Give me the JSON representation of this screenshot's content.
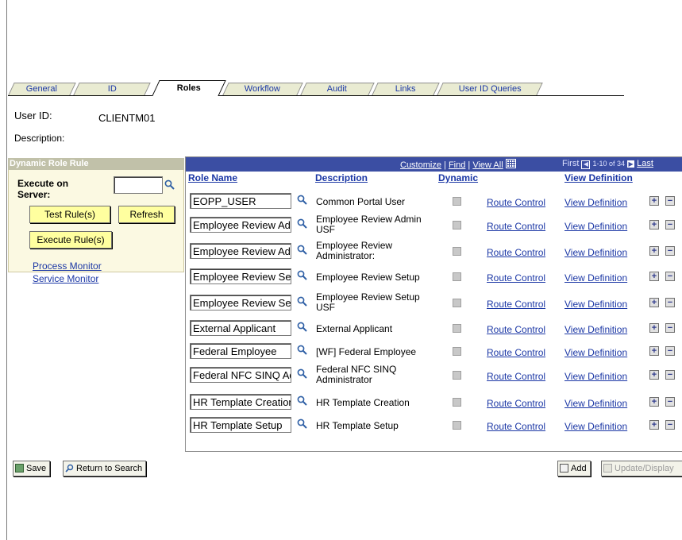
{
  "tabs": [
    {
      "label": "General"
    },
    {
      "label": "ID"
    },
    {
      "label": "Roles"
    },
    {
      "label": "Workflow"
    },
    {
      "label": "Audit"
    },
    {
      "label": "Links"
    },
    {
      "label": "User ID Queries"
    }
  ],
  "user": {
    "id_label": "User ID:",
    "id_value": "CLIENTM01",
    "description_label": "Description:"
  },
  "rule_panel": {
    "title": "Dynamic Role Rule",
    "execute_label": "Execute on Server:",
    "server_value": "",
    "test_button": "Test Rule(s)",
    "refresh_button": "Refresh",
    "execute_button": "Execute Rule(s)",
    "process_monitor": "Process Monitor",
    "service_monitor": "Service Monitor"
  },
  "grid": {
    "customize": "Customize",
    "find": "Find",
    "view_all": "View All",
    "first": "First",
    "range": "1-10 of 34",
    "last": "Last",
    "columns": {
      "role_name": "Role Name",
      "description": "Description",
      "dynamic": "Dynamic",
      "view_definition": "View Definition"
    },
    "rows": [
      {
        "role": "EOPP_USER",
        "desc": "Common Portal User",
        "route": "Route Control",
        "view": "View Definition"
      },
      {
        "role": "Employee Review Admin USF",
        "desc": "Employee Review Admin USF",
        "route": "Route Control",
        "view": "View Definition"
      },
      {
        "role": "Employee Review Administrator",
        "desc": "Employee Review Administrator:",
        "route": "Route Control",
        "view": "View Definition"
      },
      {
        "role": "Employee Review Setup",
        "desc": "Employee Review Setup",
        "route": "Route Control",
        "view": "View Definition"
      },
      {
        "role": "Employee Review Setup USF",
        "desc": "Employee Review Setup USF",
        "route": "Route Control",
        "view": "View Definition"
      },
      {
        "role": "External Applicant",
        "desc": "External Applicant",
        "route": "Route Control",
        "view": "View Definition"
      },
      {
        "role": "Federal Employee",
        "desc": "[WF] Federal Employee",
        "route": "Route Control",
        "view": "View Definition"
      },
      {
        "role": "Federal NFC SINQ Administrator",
        "desc": "Federal NFC SINQ Administrator",
        "route": "Route Control",
        "view": "View Definition"
      },
      {
        "role": "HR Template Creation",
        "desc": "HR Template Creation",
        "route": "Route Control",
        "view": "View Definition"
      },
      {
        "role": "HR Template Setup",
        "desc": "HR Template Setup",
        "route": "Route Control",
        "view": "View Definition"
      }
    ]
  },
  "footer": {
    "save": "Save",
    "return": "Return to Search",
    "add": "Add",
    "update": "Update/Display"
  }
}
